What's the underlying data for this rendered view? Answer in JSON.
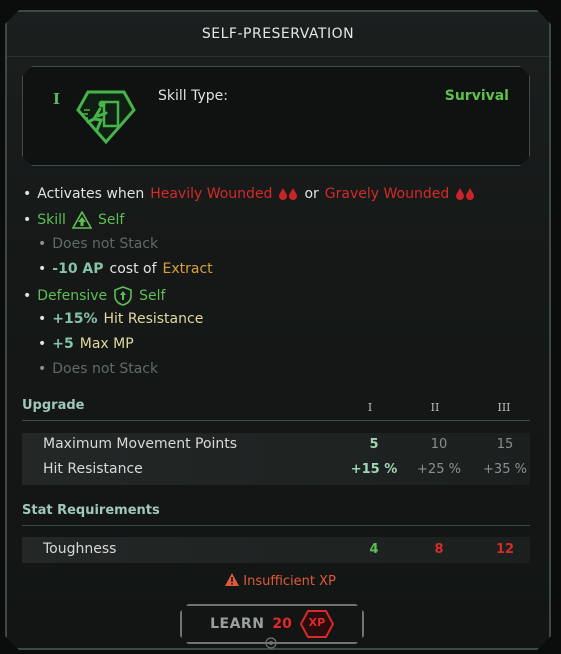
{
  "title": "SELF-PRESERVATION",
  "skill": {
    "tier": "I",
    "icon": "running-man-exit-icon",
    "type_label": "Skill Type:",
    "type_value": "Survival"
  },
  "effects": {
    "activates_prefix": "Activates when",
    "cond1": "Heavily Wounded",
    "or": "or",
    "cond2": "Gravely Wounded",
    "skill_label": "Skill",
    "skill_target": "Self",
    "no_stack_1": "Does not Stack",
    "ap_value": "-10 AP",
    "ap_text": "cost of",
    "ap_target": "Extract",
    "defensive_label": "Defensive",
    "defensive_target": "Self",
    "hit_res_value": "+15%",
    "hit_res_label": "Hit Resistance",
    "mp_value": "+5",
    "mp_label": "Max MP",
    "no_stack_2": "Does not Stack"
  },
  "upgrade": {
    "header": "Upgrade",
    "levels": [
      "I",
      "II",
      "III"
    ],
    "rows": [
      {
        "name": "Maximum Movement Points",
        "values": [
          "5",
          "10",
          "15"
        ]
      },
      {
        "name": "Hit Resistance",
        "values": [
          "+15 %",
          "+25 %",
          "+35 %"
        ]
      }
    ]
  },
  "requirements": {
    "header": "Stat Requirements",
    "rows": [
      {
        "name": "Toughness",
        "values": [
          "4",
          "8",
          "12"
        ]
      }
    ]
  },
  "warning": "Insufficient XP",
  "learn": {
    "label": "LEARN",
    "cost": "20",
    "currency": "XP"
  },
  "colors": {
    "accent_green": "#5fbf55",
    "danger_red": "#d42a2a",
    "extract_orange": "#d9a03a"
  }
}
